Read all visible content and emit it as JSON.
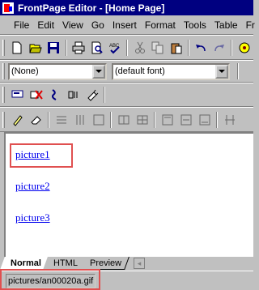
{
  "window": {
    "title": "FrontPage Editor - [Home Page]"
  },
  "menu": [
    "File",
    "Edit",
    "View",
    "Go",
    "Insert",
    "Format",
    "Tools",
    "Table",
    "Fr"
  ],
  "format_toolbar": {
    "style_value": "(None)",
    "font_value": "(default font)"
  },
  "editor": {
    "links": [
      "picture1",
      "picture2",
      "picture3"
    ]
  },
  "view_tabs": [
    "Normal",
    "HTML",
    "Preview"
  ],
  "status": {
    "text": "pictures/an00020a.gif"
  },
  "colors": {
    "titlebar": "#000080",
    "link": "#0000ee",
    "highlight": "#e05050",
    "chrome": "#c0c0c0"
  }
}
